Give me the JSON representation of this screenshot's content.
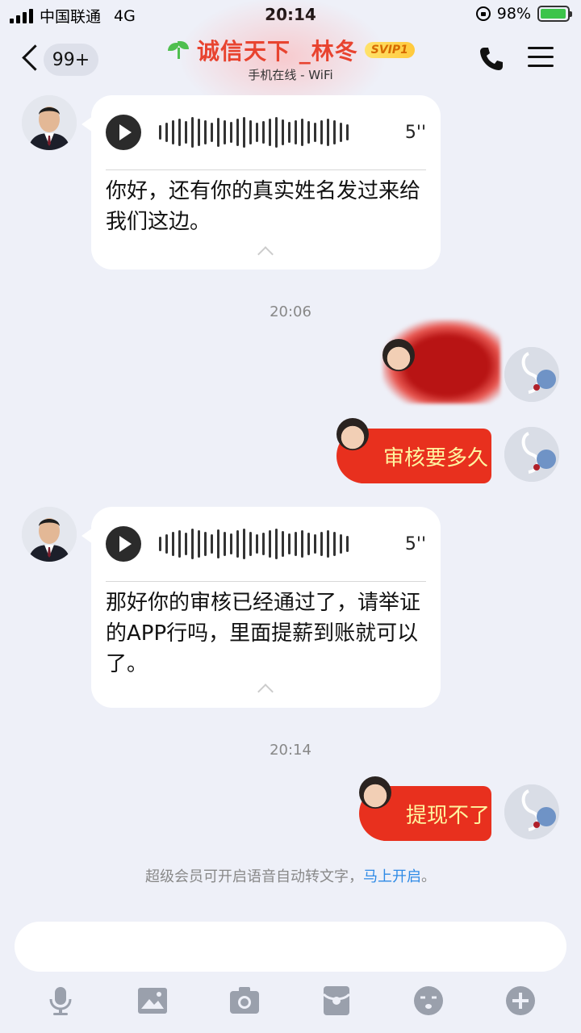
{
  "status_bar": {
    "carrier": "中国联通",
    "network": "4G",
    "time": "20:14",
    "battery": "98%",
    "battery_level": 0.98
  },
  "header": {
    "unread_count": "99+",
    "contact_name": "诚信天下 _林冬",
    "vip_badge": "SVIP1",
    "online_status": "手机在线 - WiFi",
    "colors": {
      "name": "#e8432f",
      "vip": "#ffd54a"
    }
  },
  "messages": [
    {
      "type": "voice",
      "direction": "incoming",
      "duration": "5''",
      "transcript": "你好，还有你的真实姓名发过来给我们这边。"
    },
    {
      "type": "time",
      "text": "20:06"
    },
    {
      "type": "redacted",
      "direction": "outgoing"
    },
    {
      "type": "sticker_text",
      "direction": "outgoing",
      "text": "审核要多久"
    },
    {
      "type": "voice",
      "direction": "incoming",
      "duration": "5''",
      "transcript": "那好你的审核已经通过了，请举证的APP行吗，里面提薪到账就可以了。"
    },
    {
      "type": "time",
      "text": "20:14"
    },
    {
      "type": "sticker_text",
      "direction": "outgoing",
      "text": "提现不了"
    }
  ],
  "hint": {
    "text": "超级会员可开启语音自动转文字，",
    "link": "马上开启",
    "suffix": "。"
  },
  "input": {
    "placeholder": ""
  },
  "toolbar": [
    "mic-icon",
    "image-icon",
    "camera-icon",
    "red-packet-icon",
    "emoji-icon",
    "plus-icon"
  ]
}
